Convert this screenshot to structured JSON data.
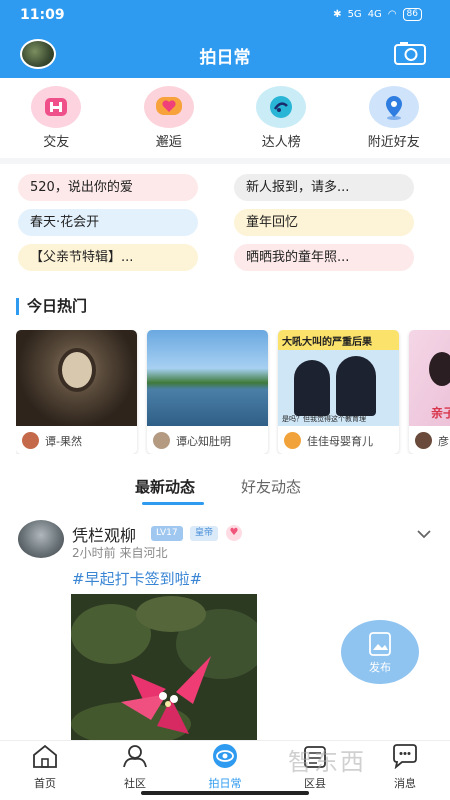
{
  "status_bar": {
    "time": "11:09",
    "signal1": "5G",
    "signal2": "4G",
    "battery": "86"
  },
  "header": {
    "title": "拍日常"
  },
  "quick_entries": [
    {
      "label": "交友",
      "icon": "friends-icon"
    },
    {
      "label": "邂逅",
      "icon": "heart-chat-icon"
    },
    {
      "label": "达人榜",
      "icon": "ranking-icon"
    },
    {
      "label": "附近好友",
      "icon": "location-icon"
    }
  ],
  "topics": [
    {
      "label": "520，说出你的爱",
      "color": "#fde9ea"
    },
    {
      "label": "新人报到，请多...",
      "color": "#eeeeee"
    },
    {
      "label": "春天·花会开",
      "color": "#e3f1fd"
    },
    {
      "label": "童年回忆",
      "color": "#fdf3d6"
    },
    {
      "label": "【父亲节特辑】...",
      "color": "#fdf3d6"
    },
    {
      "label": "晒晒我的童年照...",
      "color": "#fde9ea"
    }
  ],
  "hot": {
    "title": "今日热门",
    "cards": [
      {
        "author": "谭-果然"
      },
      {
        "author": "谭心知肚明"
      },
      {
        "author": "佳佳母婴育儿",
        "img_title": "大吼大叫的严重后果",
        "img_caption": "是吗？但我觉得这个教育理"
      },
      {
        "author": "彦",
        "img_text": "亲子"
      }
    ]
  },
  "tabs": [
    {
      "label": "最新动态",
      "active": true
    },
    {
      "label": "好友动态",
      "active": false
    }
  ],
  "post": {
    "name": "凭栏观柳",
    "level": "LV17",
    "role": "皇帝",
    "meta": "2小时前  来自河北",
    "tag": "#早起打卡签到啦#"
  },
  "fab": {
    "label": "发布"
  },
  "nav": [
    {
      "label": "首页",
      "icon": "home-icon",
      "active": false
    },
    {
      "label": "社区",
      "icon": "community-icon",
      "active": false
    },
    {
      "label": "拍日常",
      "icon": "eye-icon",
      "active": true
    },
    {
      "label": "区县",
      "icon": "region-icon",
      "active": false
    },
    {
      "label": "消息",
      "icon": "message-icon",
      "active": false
    }
  ],
  "watermark": "智东西"
}
